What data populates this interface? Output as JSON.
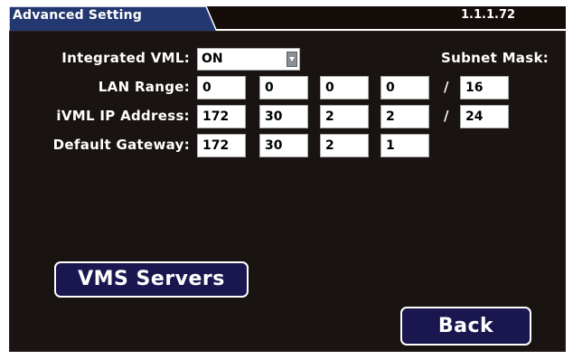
{
  "header": {
    "title": "Advanced Setting",
    "version": "1.1.1.72"
  },
  "form": {
    "integrated_vml": {
      "label": "Integrated VML:",
      "value": "ON"
    },
    "subnet_mask_label": "Subnet Mask:",
    "lan_range": {
      "label": "LAN Range:",
      "octets": [
        "0",
        "0",
        "0",
        "0"
      ],
      "mask": "16"
    },
    "ivml_ip": {
      "label": "iVML IP Address:",
      "octets": [
        "172",
        "30",
        "2",
        "2"
      ],
      "mask": "24"
    },
    "gateway": {
      "label": "Default Gateway:",
      "octets": [
        "172",
        "30",
        "2",
        "1"
      ]
    },
    "slash": "/"
  },
  "buttons": {
    "vms_servers": "VMS Servers",
    "back": "Back"
  },
  "colors": {
    "header_tab": "#233870",
    "panel_bg": "#191311",
    "button_bg": "#1a1750",
    "header_bg": "#150d0a"
  }
}
